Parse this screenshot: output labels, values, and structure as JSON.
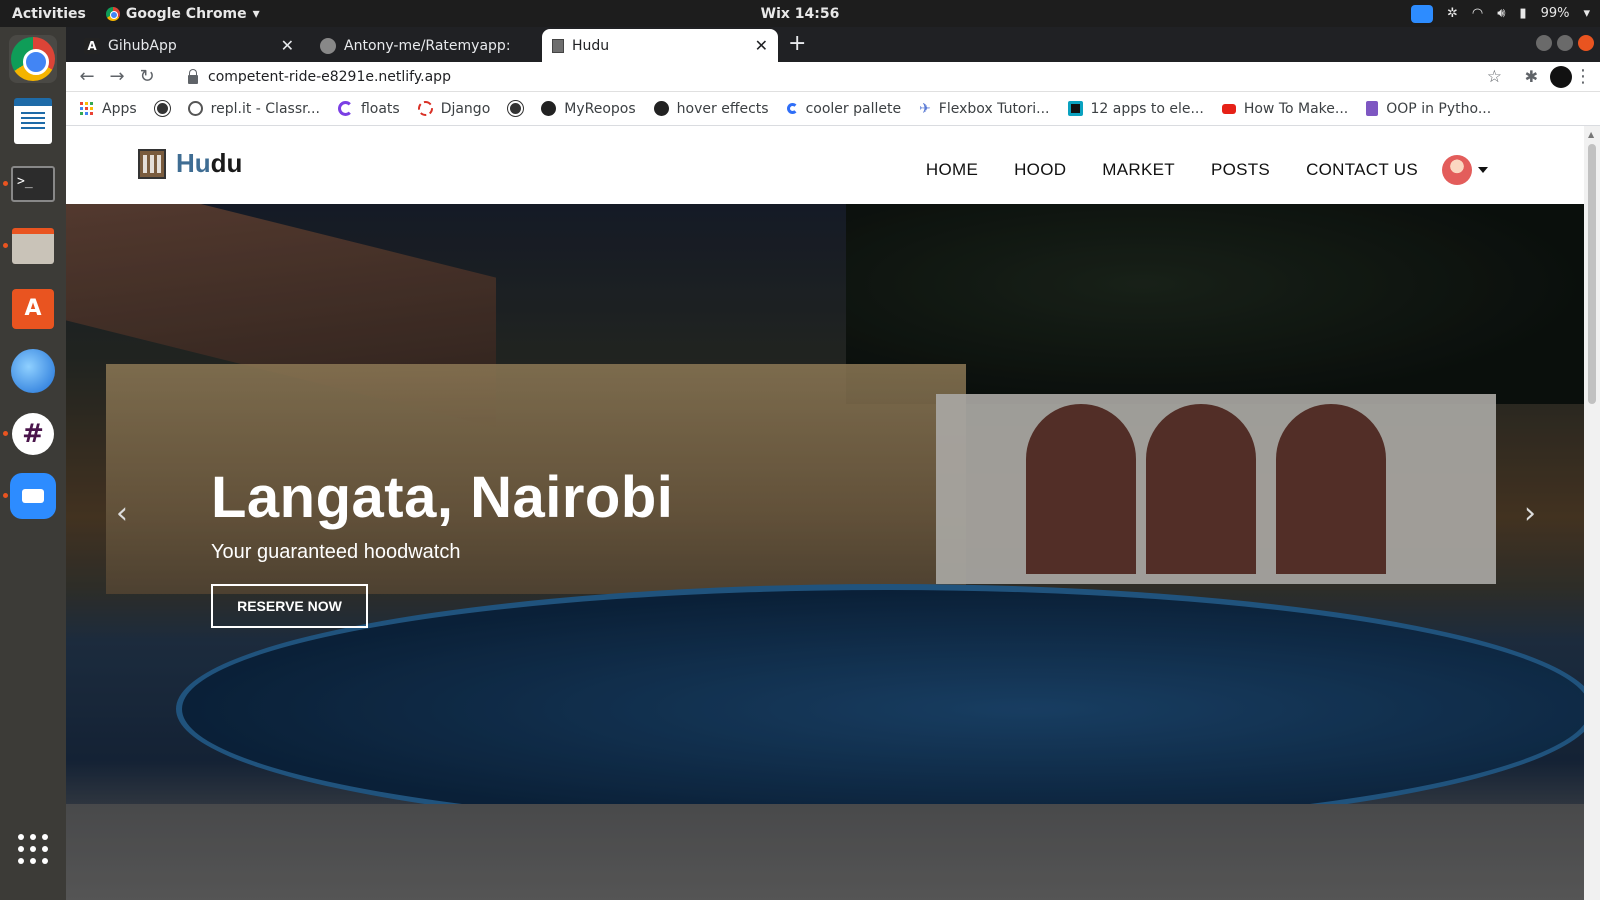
{
  "system_bar": {
    "activities": "Activities",
    "app_name": "Google Chrome",
    "clock": "Wix 14:56",
    "battery": "99%"
  },
  "browser": {
    "tabs": [
      {
        "title": "GihubApp",
        "icon": "angular-icon"
      },
      {
        "title": "Antony-me/Ratemyapp: R",
        "icon": "github-icon"
      },
      {
        "title": "Hudu",
        "icon": "building-icon",
        "active": true
      }
    ],
    "url": "competent-ride-e8291e.netlify.app",
    "bookmarks": [
      {
        "label": "Apps",
        "icon": "apps-grid-icon",
        "color": "#4285f4"
      },
      {
        "label": "",
        "icon": "globe-icon",
        "color": "#333333"
      },
      {
        "label": "repl.it - Classr...",
        "icon": "replit-icon",
        "color": "#555555"
      },
      {
        "label": "floats",
        "icon": "floats-icon",
        "color": "#7b3fe4"
      },
      {
        "label": "Django",
        "icon": "django-icon",
        "color": "#d93025"
      },
      {
        "label": "",
        "icon": "globe-icon",
        "color": "#333333"
      },
      {
        "label": "MyReopos",
        "icon": "github-icon",
        "color": "#222222"
      },
      {
        "label": "hover effects",
        "icon": "github-icon",
        "color": "#222222"
      },
      {
        "label": "cooler pallete",
        "icon": "coolors-icon",
        "color": "#2f6ef7"
      },
      {
        "label": "Flexbox Tutori...",
        "icon": "flexbox-icon",
        "color": "#5b7bd5"
      },
      {
        "label": "12 apps to ele...",
        "icon": "article-icon",
        "color": "#0aa2c0"
      },
      {
        "label": "How To Make...",
        "icon": "youtube-icon",
        "color": "#e62117"
      },
      {
        "label": "OOP in Pytho...",
        "icon": "docs-icon",
        "color": "#7e57c2"
      }
    ]
  },
  "site": {
    "brand_hu": "Hu",
    "brand_du": "du",
    "nav": [
      "HOME",
      "HOOD",
      "MARKET",
      "POSTS",
      "CONTACT US"
    ],
    "hero": {
      "title": "Langata, Nairobi",
      "subtitle": "Your guaranteed hoodwatch",
      "cta": "RESERVE NOW"
    }
  },
  "colors": {
    "brand_accent": "#3f6d93",
    "ubuntu_orange": "#e95420",
    "dock_bg": "#3c3b37"
  }
}
